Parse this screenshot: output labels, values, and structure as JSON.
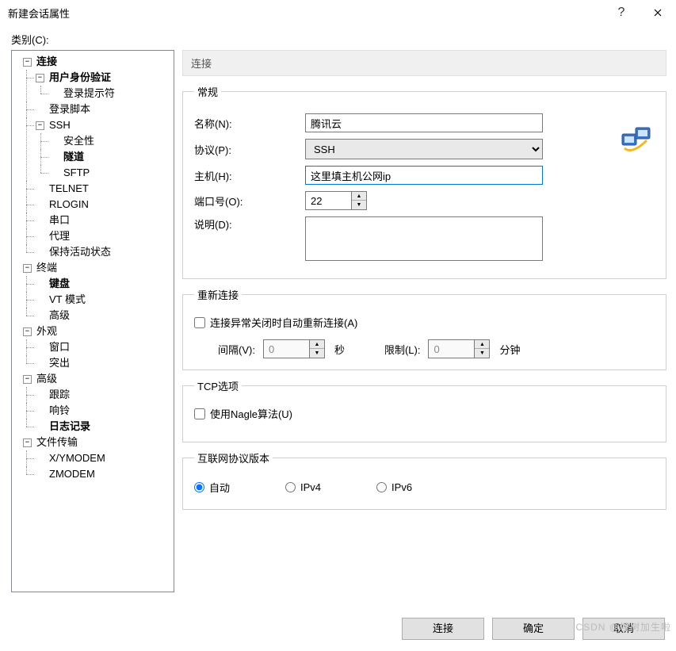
{
  "title": "新建会话属性",
  "category_label": "类别(C):",
  "tree": {
    "n_connect": "连接",
    "n_userauth": "用户身份验证",
    "n_loginprompt": "登录提示符",
    "n_loginscript": "登录脚本",
    "n_ssh": "SSH",
    "n_security": "安全性",
    "n_tunnel": "隧道",
    "n_sftp": "SFTP",
    "n_telnet": "TELNET",
    "n_rlogin": "RLOGIN",
    "n_serial": "串口",
    "n_proxy": "代理",
    "n_keepalive": "保持活动状态",
    "n_terminal": "终端",
    "n_keyboard": "键盘",
    "n_vtmode": "VT 模式",
    "n_advanced": "高级",
    "n_appearance": "外观",
    "n_window": "窗口",
    "n_highlight": "突出",
    "n_advanced2": "高级",
    "n_trace": "跟踪",
    "n_bell": "响铃",
    "n_logging": "日志记录",
    "n_filetransfer": "文件传输",
    "n_xymodem": "X/YMODEM",
    "n_zmodem": "ZMODEM"
  },
  "header": "连接",
  "general": {
    "legend": "常规",
    "name_label": "名称(N):",
    "name_value": "腾讯云",
    "protocol_label": "协议(P):",
    "protocol_value": "SSH",
    "host_label": "主机(H):",
    "host_value": "这里填主机公网ip",
    "port_label": "端口号(O):",
    "port_value": "22",
    "desc_label": "说明(D):",
    "desc_value": ""
  },
  "reconnect": {
    "legend": "重新连接",
    "checkbox": "连接异常关闭时自动重新连接(A)",
    "interval_label": "间隔(V):",
    "interval_value": "0",
    "interval_unit": "秒",
    "limit_label": "限制(L):",
    "limit_value": "0",
    "limit_unit": "分钟"
  },
  "tcp": {
    "legend": "TCP选项",
    "nagle": "使用Nagle算法(U)"
  },
  "ipver": {
    "legend": "互联网协议版本",
    "auto": "自动",
    "ipv4": "IPv4",
    "ipv6": "IPv6"
  },
  "buttons": {
    "connect": "连接",
    "ok": "确定",
    "cancel": "取消"
  },
  "watermark": "CSDN @埋树加生啦"
}
